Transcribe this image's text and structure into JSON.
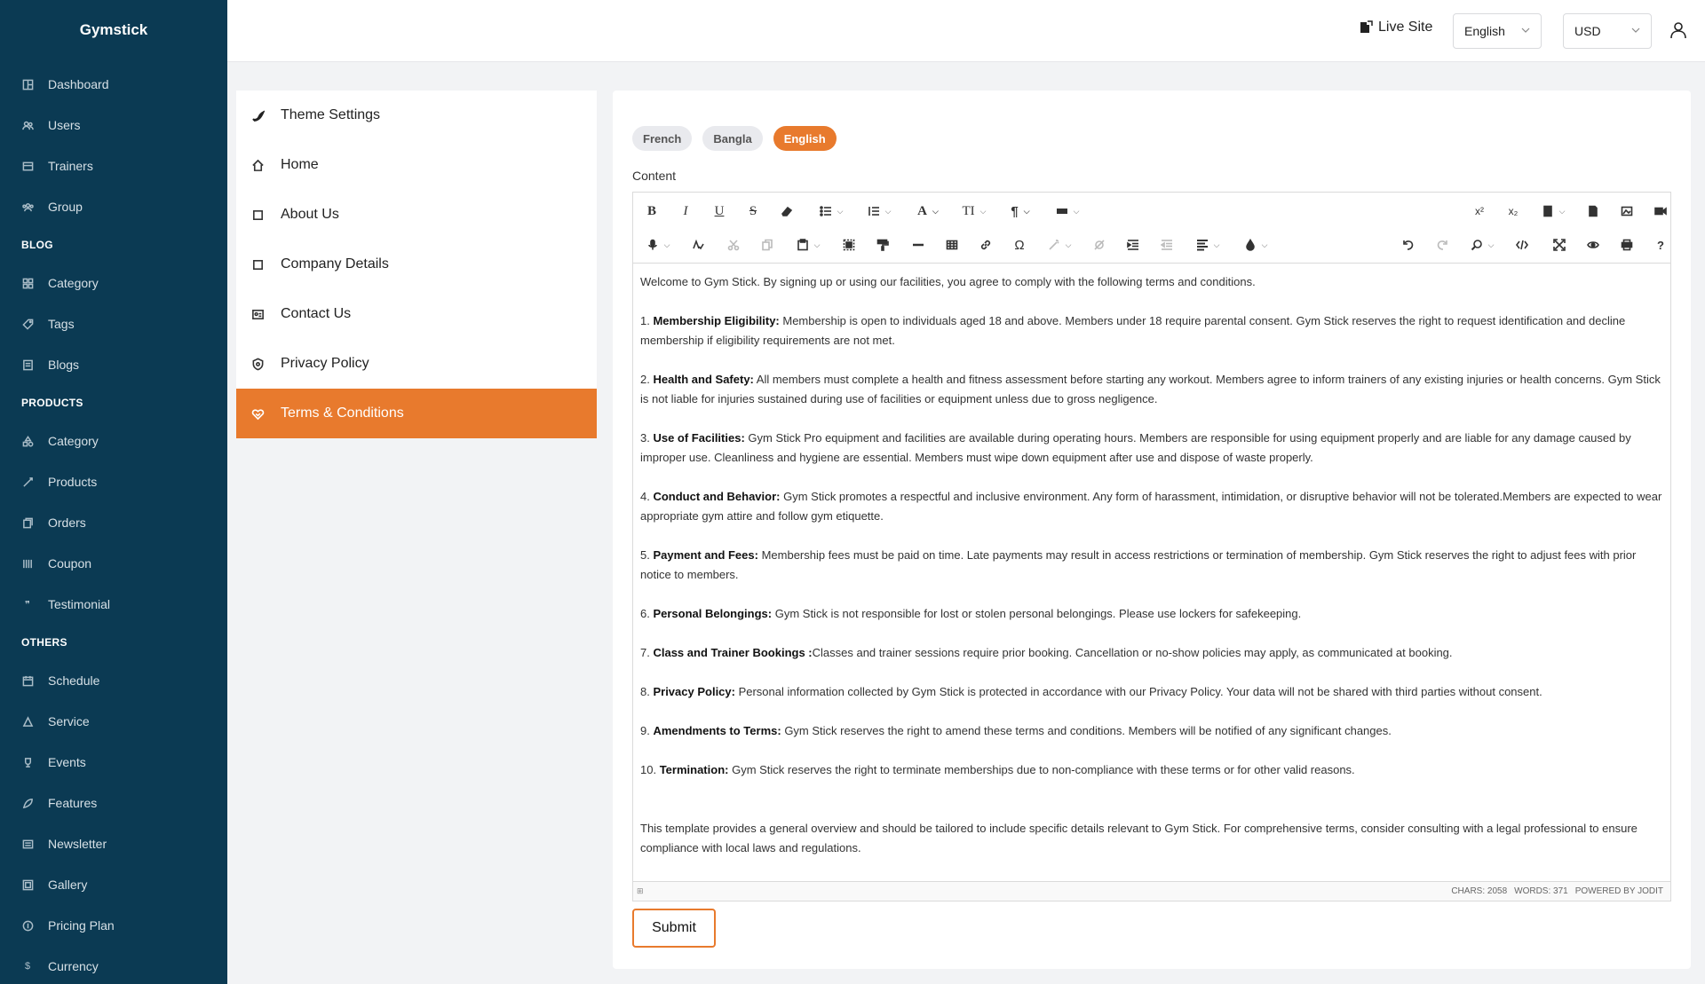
{
  "brand": "Gymstick",
  "sidebar": {
    "items_main": [
      {
        "label": "Dashboard",
        "icon": "dashboard-icon"
      },
      {
        "label": "Users",
        "icon": "users-icon"
      },
      {
        "label": "Trainers",
        "icon": "trainers-icon"
      },
      {
        "label": "Group",
        "icon": "group-icon"
      }
    ],
    "section_blog": "BLOG",
    "items_blog": [
      {
        "label": "Category",
        "icon": "category-icon"
      },
      {
        "label": "Tags",
        "icon": "tag-icon"
      },
      {
        "label": "Blogs",
        "icon": "blogs-icon"
      }
    ],
    "section_products": "PRODUCTS",
    "items_products": [
      {
        "label": "Category",
        "icon": "category-icon"
      },
      {
        "label": "Products",
        "icon": "products-icon"
      },
      {
        "label": "Orders",
        "icon": "orders-icon"
      },
      {
        "label": "Coupon",
        "icon": "coupon-icon"
      },
      {
        "label": "Testimonial",
        "icon": "quote-icon"
      }
    ],
    "section_others": "OTHERS",
    "items_others": [
      {
        "label": "Schedule",
        "icon": "schedule-icon"
      },
      {
        "label": "Service",
        "icon": "service-icon"
      },
      {
        "label": "Events",
        "icon": "trophy-icon"
      },
      {
        "label": "Features",
        "icon": "features-icon"
      },
      {
        "label": "Newsletter",
        "icon": "newsletter-icon"
      },
      {
        "label": "Gallery",
        "icon": "gallery-icon"
      },
      {
        "label": "Pricing Plan",
        "icon": "pricing-icon"
      },
      {
        "label": "Currency",
        "icon": "currency-icon"
      }
    ]
  },
  "topbar": {
    "live_site": "Live Site",
    "language": "English",
    "currency": "USD"
  },
  "settings_menu": [
    {
      "label": "Theme Settings",
      "icon": "theme-icon"
    },
    {
      "label": "Home",
      "icon": "home-icon"
    },
    {
      "label": "About Us",
      "icon": "page-icon"
    },
    {
      "label": "Company Details",
      "icon": "page-icon"
    },
    {
      "label": "Contact Us",
      "icon": "contact-icon"
    },
    {
      "label": "Privacy Policy",
      "icon": "shield-icon"
    },
    {
      "label": "Terms & Conditions",
      "icon": "handshake-icon",
      "active": true
    }
  ],
  "content": {
    "lang_tabs": [
      "French",
      "Bangla",
      "English"
    ],
    "active_lang": "English",
    "label": "Content",
    "intro": "Welcome to Gym Stick. By signing up or using our facilities, you agree to comply with the following terms and conditions.",
    "terms": [
      {
        "num": "1.",
        "title": "Membership Eligibility:",
        "text": " Membership is open to individuals aged 18 and above. Members under 18 require parental consent. Gym Stick  reserves the right to request identification and decline membership if eligibility requirements are not met."
      },
      {
        "num": "2.",
        "title": "Health and Safety:",
        "text": " All members must complete a health and fitness assessment before starting any workout. Members agree to inform trainers of any existing injuries or health concerns. Gym Stick  is not liable for injuries sustained during use of facilities or equipment unless due to gross negligence."
      },
      {
        "num": "3.",
        "title": "Use of Facilities:",
        "text": " Gym Stick Pro equipment and facilities are available during operating hours. Members are responsible for using equipment properly and are liable for any damage caused by improper use. Cleanliness and hygiene are essential. Members must wipe down equipment after use and dispose of waste properly."
      },
      {
        "num": "4.",
        "title": "Conduct and Behavior:",
        "text": " Gym Stick promotes a respectful and inclusive environment. Any form of harassment, intimidation, or disruptive behavior will not be tolerated.Members are expected to wear appropriate gym attire and follow gym etiquette."
      },
      {
        "num": "5.",
        "title": "Payment and Fees:",
        "text": " Membership fees must be paid on time. Late payments may result in access restrictions or termination of membership. Gym Stick reserves the right to adjust fees with prior notice to members."
      },
      {
        "num": "6.",
        "title": "Personal Belongings:",
        "text": " Gym Stick is not responsible for lost or stolen personal belongings. Please use lockers for safekeeping."
      },
      {
        "num": "7.",
        "title": "Class and Trainer Bookings :",
        "text": "Classes and trainer sessions require prior booking. Cancellation or no-show policies may apply, as communicated at booking."
      },
      {
        "num": "8.",
        "title": "Privacy Policy:",
        "text": " Personal information collected by Gym Stick is protected in accordance with our Privacy Policy. Your data will not be shared with third parties without consent."
      },
      {
        "num": "9.",
        "title": "Amendments to Terms:",
        "text": " Gym Stick reserves the right to amend these terms and conditions. Members will be notified of any significant changes."
      },
      {
        "num": "10.",
        "title": "Termination:",
        "text": " Gym Stick reserves the right to terminate memberships due to non-compliance with these terms or for other valid reasons."
      }
    ],
    "outro": "This template provides a general overview and should be tailored to include specific details relevant to Gym Stick. For comprehensive terms, consider consulting with a legal professional to ensure compliance with local laws and regulations.",
    "status": {
      "chars": "CHARS: 2058",
      "words": "WORDS: 371",
      "powered": "POWERED BY JODIT"
    },
    "submit": "Submit"
  },
  "toolbar": {
    "bold": "B",
    "italic": "I",
    "underline": "U",
    "strike": "S",
    "font": "A",
    "fontsize": "TI",
    "paragraph": "¶",
    "superscript": "x²",
    "subscript": "x₂",
    "omega": "Ω",
    "help": "?"
  },
  "colors": {
    "sidebar_bg": "#0b3a53",
    "accent": "#e87a2d"
  }
}
